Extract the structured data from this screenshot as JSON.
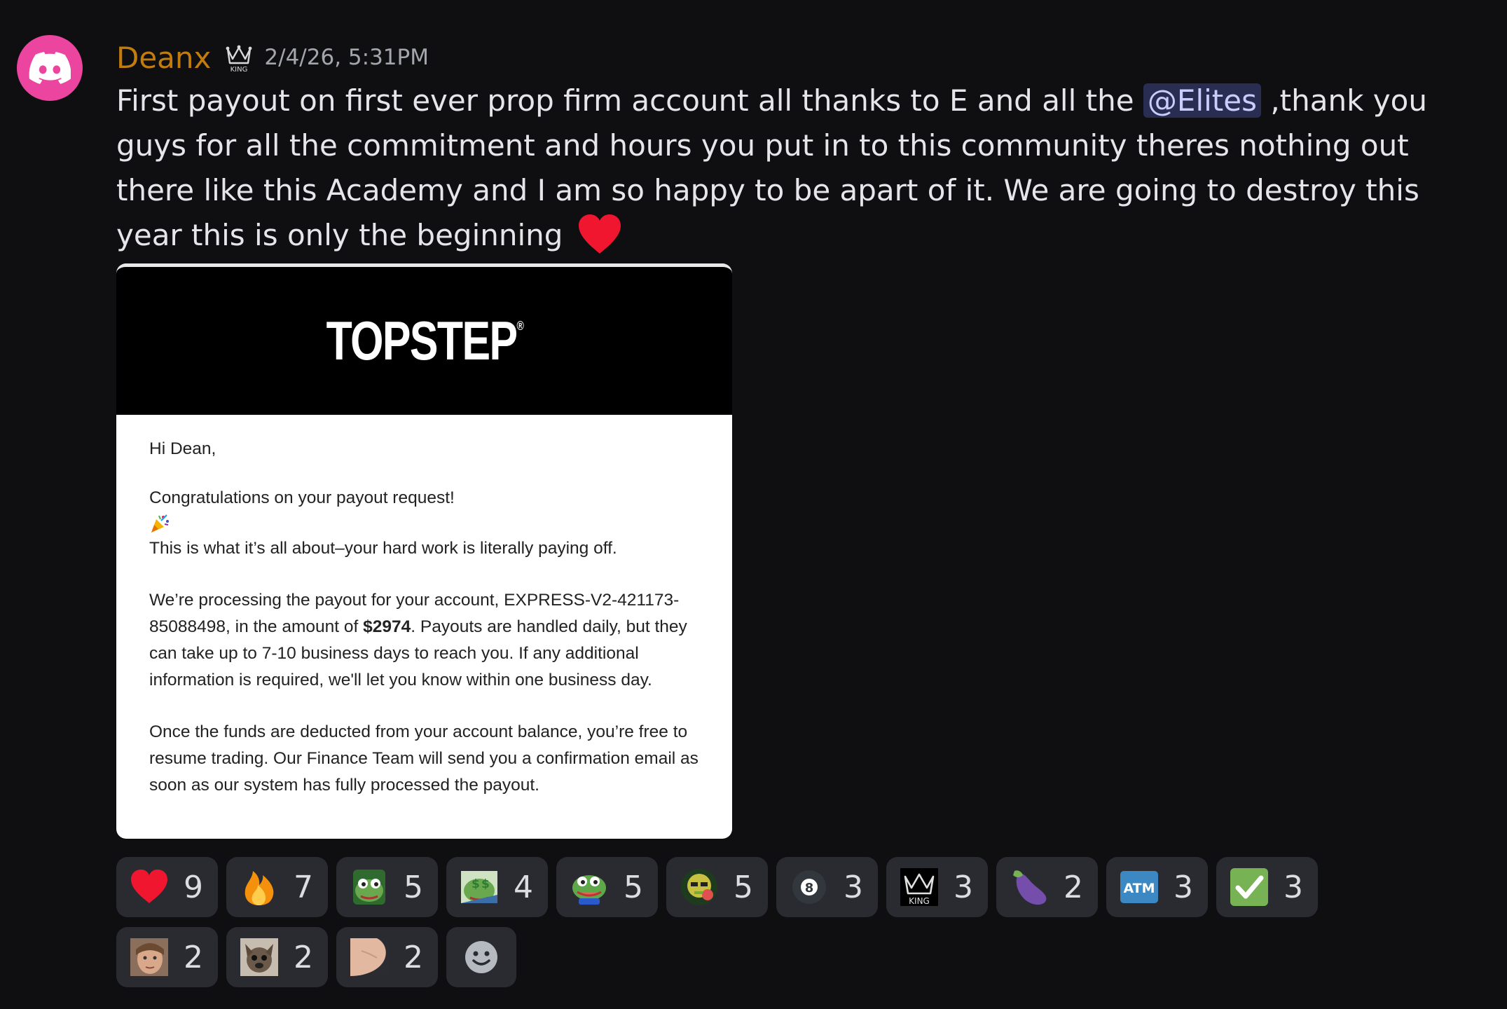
{
  "author": {
    "name": "Deanx",
    "timestamp": "2/4/26, 5:31PM",
    "badge_icon": "crown-king-icon",
    "avatar_icon": "discord-logo-icon",
    "avatar_color": "#eb459f",
    "name_color": "#c27c0e"
  },
  "message": {
    "text_before_mention": "First payout on first ever prop firm account all thanks to E and all the ",
    "mention": "@Elites",
    "text_after_mention": " ,thank you guys for all the commitment and hours you put in to this community theres nothing out there like this Academy and I am so happy to be apart of it. We are going to destroy this year this is only the beginning",
    "trailing_emoji": "red-heart-icon"
  },
  "attachment": {
    "brand": "TOPSTEP",
    "greeting": "Hi Dean,",
    "congrats": "Congratulations on your payout request!",
    "congrats_emoji": "party-popper-icon",
    "tagline": "This is what it’s all about–your hard work is literally paying off.",
    "para2_before": "We’re processing the payout for your account, EXPRESS-V2-421173-85088498, in the amount of ",
    "para2_amount": "$2974",
    "para2_after": ". Payouts are handled daily, but they can take up to 7-10 business days to reach you. If any additional information is required, we'll let you know within one business day.",
    "para3": "Once the funds are deducted from your account balance, you’re free to resume trading. Our Finance Team will send you a confirmation email as soon as our system has fully processed the payout."
  },
  "reactions": [
    {
      "icon": "red-heart-icon",
      "count": "9"
    },
    {
      "icon": "fire-icon",
      "count": "7"
    },
    {
      "icon": "pepe-frog-icon",
      "count": "5"
    },
    {
      "icon": "pepe-money-icon",
      "count": "4"
    },
    {
      "icon": "pepe-happy-icon",
      "count": "5"
    },
    {
      "icon": "green-emote-icon",
      "count": "5"
    },
    {
      "icon": "eight-ball-icon",
      "count": "3"
    },
    {
      "icon": "crown-king-icon",
      "count": "3"
    },
    {
      "icon": "eggplant-icon",
      "count": "2"
    },
    {
      "icon": "atm-icon",
      "count": "3"
    },
    {
      "icon": "check-mark-icon",
      "count": "3"
    },
    {
      "icon": "face-photo-icon",
      "count": "2"
    },
    {
      "icon": "dog-photo-icon",
      "count": "2"
    },
    {
      "icon": "hand-photo-icon",
      "count": "2"
    }
  ],
  "add_reaction_icon": "add-reaction-smiley-icon"
}
